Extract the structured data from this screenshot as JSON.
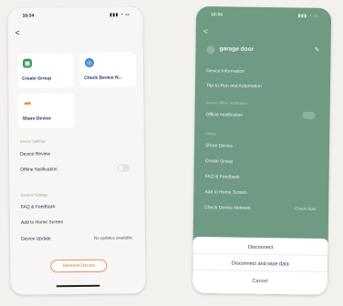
{
  "left_screen": {
    "status_time": "10:34",
    "status_icons": "▮▮▮ ◔ ▭",
    "back_label": "<",
    "tiles": [
      {
        "label": "Create Group",
        "icon": "group-icon",
        "color": "#3a9a5b"
      },
      {
        "label": "Check Device N...",
        "icon": "network-icon",
        "color": "#3a7fd0"
      },
      {
        "label": "Share Device",
        "icon": "share-icon",
        "color": "#f28a2e"
      }
    ],
    "section_device_settings": "Device Settings",
    "rows_device": [
      {
        "label": "Device Review"
      },
      {
        "label": "Offline Notification"
      }
    ],
    "section_general": "General Settings",
    "rows_general": [
      {
        "label": "FAQ & Feedback"
      },
      {
        "label": "Add to Home Screen"
      },
      {
        "label": "Device Update",
        "value": "No updates available"
      }
    ],
    "remove_button": "Remove Device"
  },
  "right_screen": {
    "status_time": "10:34",
    "status_icons": "▮▮▮ ◔ ▭",
    "back_label": "<",
    "device_name": "garage door",
    "edit_label": "✎",
    "rows_top": [
      {
        "label": "Device Information"
      },
      {
        "label": "Tap-to-Run and Automation"
      }
    ],
    "section_device_settings": "Device Offline Notification",
    "rows_mid": [
      {
        "label": "Offline Notification"
      }
    ],
    "section_others": "Others",
    "rows_others": [
      {
        "label": "Share Device"
      },
      {
        "label": "Create Group"
      },
      {
        "label": "FAQ & Feedback"
      },
      {
        "label": "Add to Home Screen"
      },
      {
        "label": "Check Device Network",
        "value": "Check Now"
      }
    ],
    "sheet": {
      "disconnect": "Disconnect",
      "disconnect_wipe": "Disconnect and wipe data",
      "cancel": "Cancel"
    }
  }
}
